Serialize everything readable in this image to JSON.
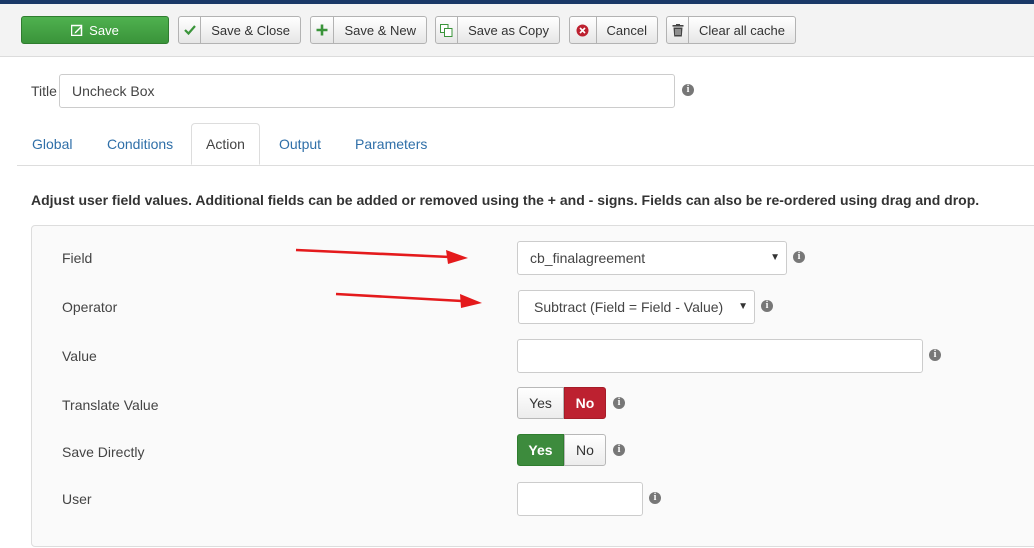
{
  "toolbar": {
    "save": "Save",
    "save_close": "Save & Close",
    "save_new": "Save & New",
    "save_copy": "Save as Copy",
    "cancel": "Cancel",
    "clear_cache": "Clear all cache"
  },
  "title_field": {
    "label": "Title",
    "value": "Uncheck Box"
  },
  "tabs": [
    "Global",
    "Conditions",
    "Action",
    "Output",
    "Parameters"
  ],
  "active_tab": "Action",
  "description": "Adjust user field values. Additional fields can be added or removed using the + and - signs. Fields can also be re-ordered using drag and drop.",
  "form": {
    "field": {
      "label": "Field",
      "value": "cb_finalagreement"
    },
    "operator": {
      "label": "Operator",
      "value": "Subtract (Field = Field - Value)"
    },
    "value": {
      "label": "Value",
      "value": ""
    },
    "translate_value": {
      "label": "Translate Value",
      "yes": "Yes",
      "no": "No",
      "selected": "No"
    },
    "save_directly": {
      "label": "Save Directly",
      "yes": "Yes",
      "no": "No",
      "selected": "Yes"
    },
    "user": {
      "label": "User",
      "value": ""
    }
  },
  "colors": {
    "save_green": "#46a546",
    "no_red": "#bd2130",
    "yes_green": "#3d8b3d",
    "annotation_red": "#e41a1c",
    "topbar": "#1a3867"
  }
}
